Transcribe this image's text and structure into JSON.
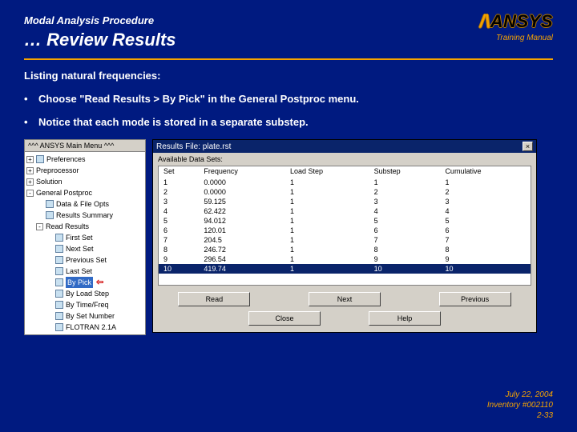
{
  "header": {
    "breadcrumb": "Modal Analysis Procedure",
    "title": "… Review Results",
    "logo_main": "ANSYS",
    "training": "Training Manual"
  },
  "body": {
    "subhead": "Listing natural frequencies:",
    "bullets": [
      "Choose \"Read Results > By Pick\" in the General Postproc menu.",
      "Notice that each mode is stored in a separate substep."
    ]
  },
  "tree": {
    "title": "^^^  ANSYS Main Menu  ^^^",
    "items": [
      {
        "d": 0,
        "box": "+",
        "icon": "doc",
        "label": "Preferences"
      },
      {
        "d": 0,
        "box": "+",
        "icon": "",
        "label": "Preprocessor"
      },
      {
        "d": 0,
        "box": "+",
        "icon": "",
        "label": "Solution"
      },
      {
        "d": 0,
        "box": "-",
        "icon": "",
        "label": "General Postproc"
      },
      {
        "d": 1,
        "box": "",
        "icon": "doc",
        "label": "Data & File Opts"
      },
      {
        "d": 1,
        "box": "",
        "icon": "doc",
        "label": "Results Summary"
      },
      {
        "d": 1,
        "box": "-",
        "icon": "",
        "label": "Read Results"
      },
      {
        "d": 2,
        "box": "",
        "icon": "doc",
        "label": "First Set"
      },
      {
        "d": 2,
        "box": "",
        "icon": "doc",
        "label": "Next Set"
      },
      {
        "d": 2,
        "box": "",
        "icon": "doc",
        "label": "Previous Set"
      },
      {
        "d": 2,
        "box": "",
        "icon": "doc",
        "label": "Last Set"
      },
      {
        "d": 2,
        "box": "",
        "icon": "doc",
        "label": "By Pick",
        "sel": true,
        "arrow": true
      },
      {
        "d": 2,
        "box": "",
        "icon": "doc",
        "label": "By Load Step"
      },
      {
        "d": 2,
        "box": "",
        "icon": "doc",
        "label": "By Time/Freq"
      },
      {
        "d": 2,
        "box": "",
        "icon": "doc",
        "label": "By Set Number"
      },
      {
        "d": 2,
        "box": "",
        "icon": "doc",
        "label": "FLOTRAN 2.1A"
      }
    ]
  },
  "dialog": {
    "title": "Results File: plate.rst",
    "subtitle": "Available Data Sets:",
    "columns": [
      "Set",
      "Frequency",
      "Load Step",
      "Substep",
      "Cumulative"
    ],
    "rows": [
      {
        "c": [
          "1",
          "0.0000",
          "1",
          "1",
          "1"
        ]
      },
      {
        "c": [
          "2",
          "0.0000",
          "1",
          "2",
          "2"
        ]
      },
      {
        "c": [
          "3",
          "59.125",
          "1",
          "3",
          "3"
        ]
      },
      {
        "c": [
          "4",
          "62.422",
          "1",
          "4",
          "4"
        ]
      },
      {
        "c": [
          "5",
          "94.012",
          "1",
          "5",
          "5"
        ]
      },
      {
        "c": [
          "6",
          "120.01",
          "1",
          "6",
          "6"
        ]
      },
      {
        "c": [
          "7",
          "204.5",
          "1",
          "7",
          "7"
        ]
      },
      {
        "c": [
          "8",
          "246.72",
          "1",
          "8",
          "8"
        ]
      },
      {
        "c": [
          "9",
          "296.54",
          "1",
          "9",
          "9"
        ]
      },
      {
        "c": [
          "10",
          "419.74",
          "1",
          "10",
          "10"
        ],
        "sel": true
      }
    ],
    "buttons_row1": [
      "Read",
      "Next",
      "Previous"
    ],
    "buttons_row2": [
      "Close",
      "Help"
    ]
  },
  "footer": {
    "date": "July 22, 2004",
    "inv": "Inventory #002110",
    "page": "2-33"
  }
}
